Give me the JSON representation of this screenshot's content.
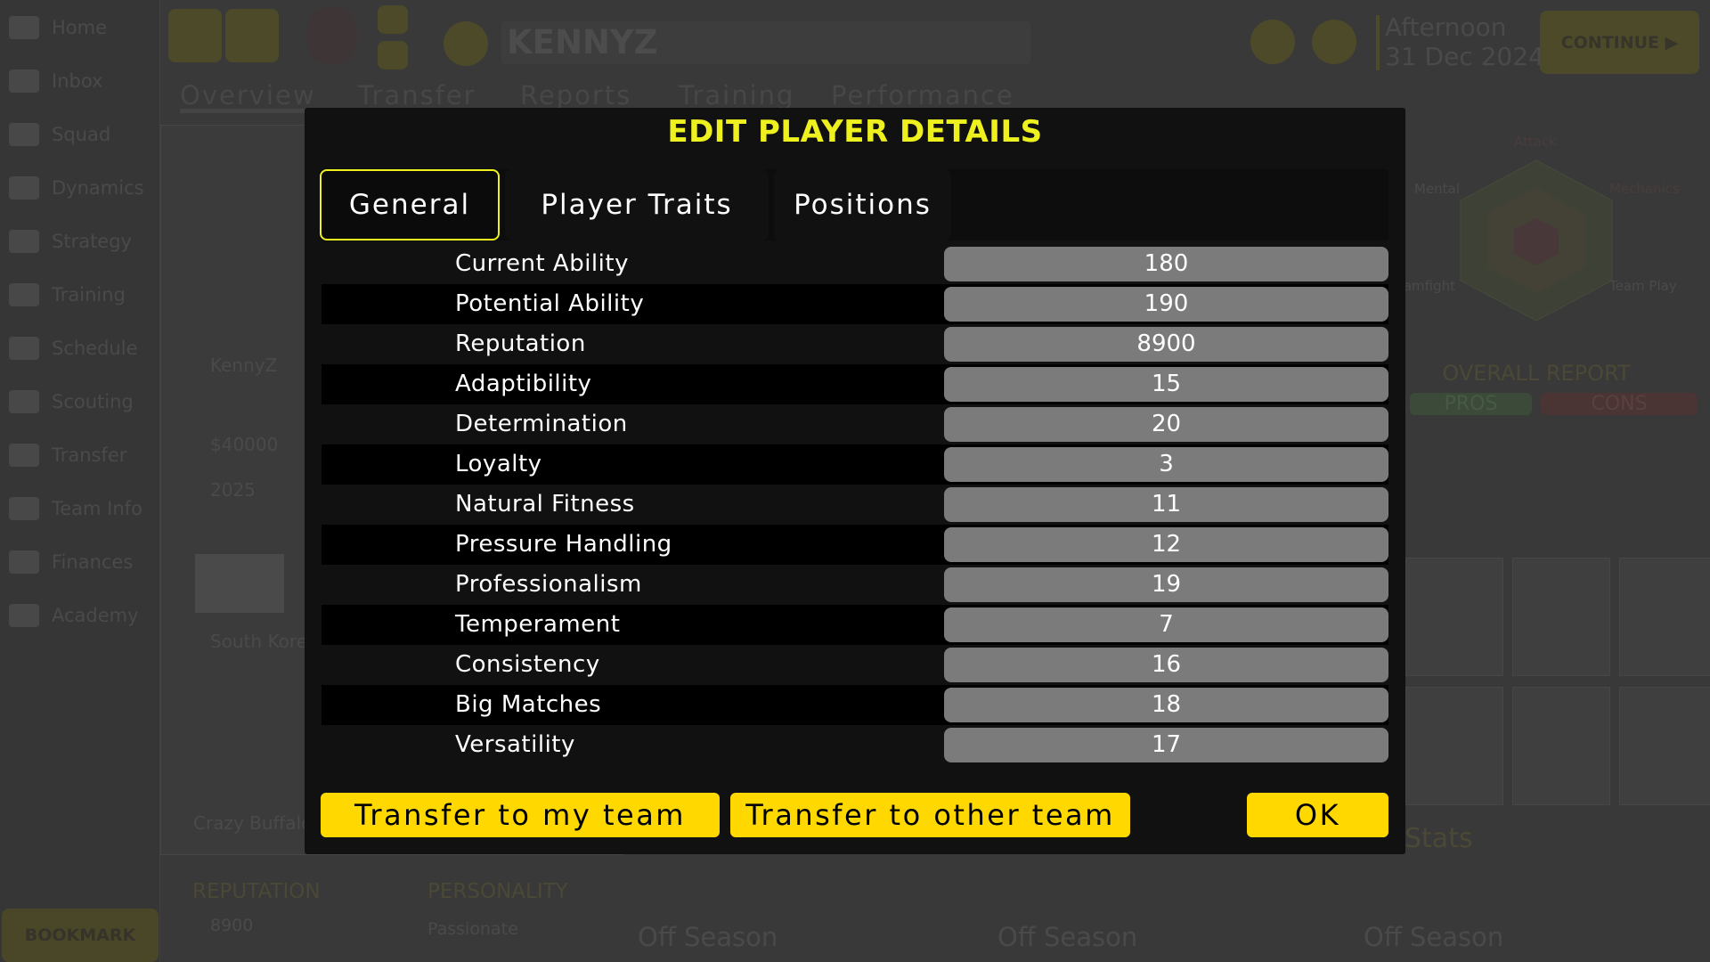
{
  "sidebar": {
    "items": [
      {
        "label": "Home",
        "icon": "home-icon"
      },
      {
        "label": "Inbox",
        "icon": "mail-icon"
      },
      {
        "label": "Squad",
        "icon": "people-icon"
      },
      {
        "label": "Dynamics",
        "icon": "dynamics-icon"
      },
      {
        "label": "Strategy",
        "icon": "strategy-icon"
      },
      {
        "label": "Training",
        "icon": "training-icon"
      },
      {
        "label": "Schedule",
        "icon": "calendar-icon"
      },
      {
        "label": "Scouting",
        "icon": "binoculars-icon"
      },
      {
        "label": "Transfer",
        "icon": "transfer-icon"
      },
      {
        "label": "Team Info",
        "icon": "shield-icon"
      },
      {
        "label": "Finances",
        "icon": "finances-icon"
      },
      {
        "label": "Academy",
        "icon": "academy-icon"
      }
    ],
    "bookmark": "BOOKMARK"
  },
  "topbar": {
    "search_value": "KENNYZ",
    "time": "Afternoon",
    "date": "31 Dec 2024",
    "continue": "CONTINUE",
    "tabs": [
      "Overview",
      "Transfer",
      "Reports",
      "Training",
      "Performance"
    ]
  },
  "background": {
    "player_name": "KennyZ",
    "value": "$40000",
    "contract": "2025",
    "nationality": "South Korea",
    "team": "Crazy Buffalo",
    "reputation_label": "REPUTATION",
    "reputation": "8900",
    "personality_label": "PERSONALITY",
    "personality": "Passionate",
    "off_season": [
      "Off Season",
      "Off Season",
      "Off Season"
    ],
    "stats": "Stats",
    "overall_report": "OVERALL REPORT",
    "pros": "PROS",
    "cons": "CONS",
    "radar_labels": {
      "attack": "Attack",
      "mental": "Mental",
      "mechanics": "Mechanics",
      "teamfight": "Teamfight",
      "teamplay": "Team Play"
    }
  },
  "modal": {
    "title": "EDIT PLAYER DETAILS",
    "tabs": [
      {
        "label": "General",
        "active": true
      },
      {
        "label": "Player Traits",
        "active": false
      },
      {
        "label": "Positions",
        "active": false
      }
    ],
    "rows": [
      {
        "label": "Current Ability",
        "value": "180"
      },
      {
        "label": "Potential Ability",
        "value": "190"
      },
      {
        "label": "Reputation",
        "value": "8900"
      },
      {
        "label": "Adaptibility",
        "value": "15"
      },
      {
        "label": "Determination",
        "value": "20"
      },
      {
        "label": "Loyalty",
        "value": "3"
      },
      {
        "label": "Natural Fitness",
        "value": "11"
      },
      {
        "label": "Pressure Handling",
        "value": "12"
      },
      {
        "label": "Professionalism",
        "value": "19"
      },
      {
        "label": "Temperament",
        "value": "7"
      },
      {
        "label": "Consistency",
        "value": "16"
      },
      {
        "label": "Big Matches",
        "value": "18"
      },
      {
        "label": "Versatility",
        "value": "17"
      }
    ],
    "buttons": {
      "transfer_my": "Transfer to my team",
      "transfer_other": "Transfer to other team",
      "ok": "OK"
    }
  },
  "colors": {
    "accent": "#eef11d",
    "button": "#ffd800",
    "value_box": "#7b7b7b"
  }
}
